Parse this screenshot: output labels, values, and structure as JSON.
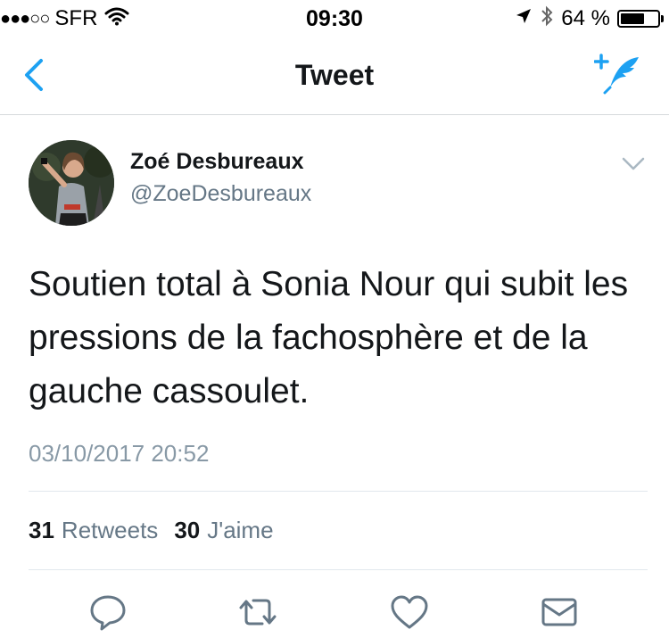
{
  "status_bar": {
    "signal_dots": "●●●○○",
    "carrier": "SFR",
    "time": "09:30",
    "battery_text": "64 %",
    "battery_level": 0.64
  },
  "nav": {
    "title": "Tweet",
    "back_icon": "chevron-left-icon",
    "compose_icon": "compose-tweet-icon",
    "accent_color": "#1da1f2"
  },
  "tweet": {
    "author_name": "Zoé Desbureaux",
    "author_handle": "@ZoeDesbureaux",
    "text": "Soutien total à Sonia Nour qui subit les pressions de la fachosphère et de la gauche cassoulet.",
    "timestamp": "03/10/2017 20:52",
    "retweets_count": "31",
    "retweets_label": "Retweets",
    "likes_count": "30",
    "likes_label": "J'aime"
  },
  "actions": [
    {
      "name": "reply-icon"
    },
    {
      "name": "retweet-icon"
    },
    {
      "name": "like-icon"
    },
    {
      "name": "message-icon"
    }
  ]
}
